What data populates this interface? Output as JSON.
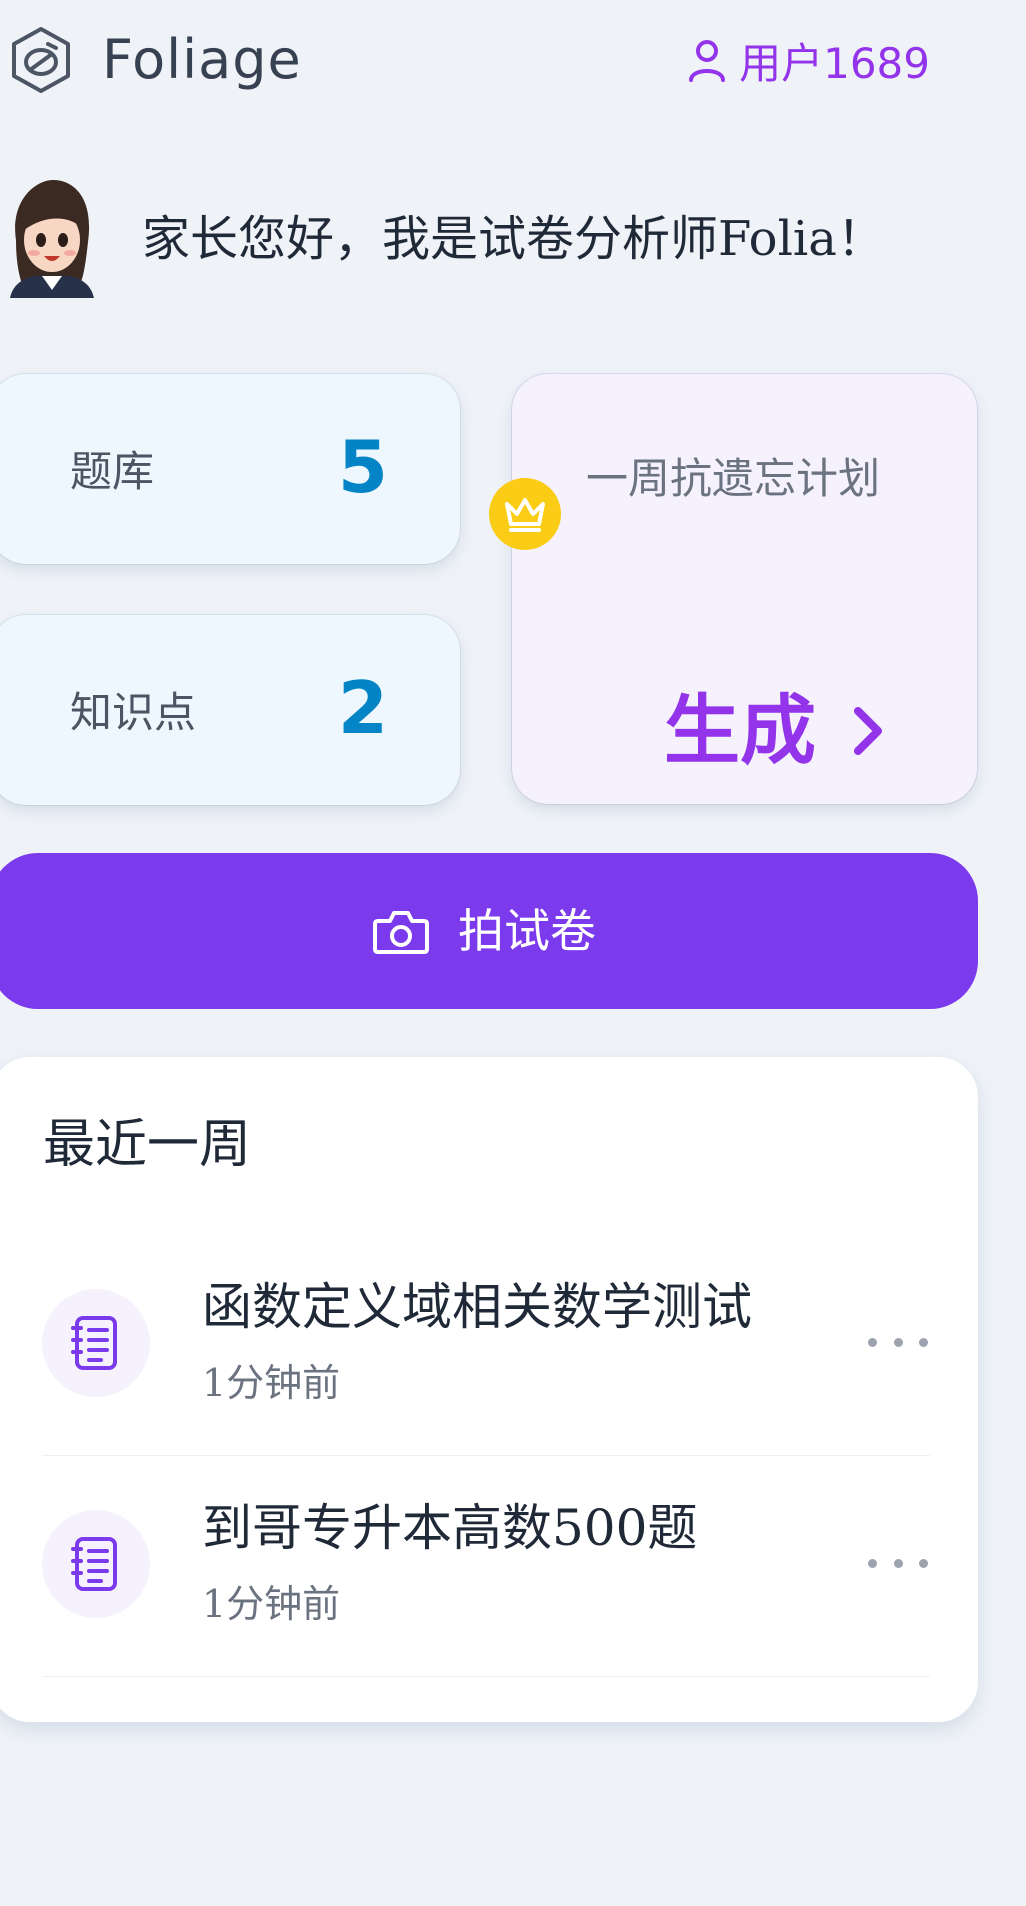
{
  "header": {
    "app_name": "Foliage",
    "user_label": "用户1689"
  },
  "greeting": {
    "text": "家长您好，我是试卷分析师Folia！"
  },
  "stats": [
    {
      "label": "题库",
      "value": "5"
    },
    {
      "label": "知识点",
      "value": "2"
    }
  ],
  "plan": {
    "title": "一周抗遗忘计划",
    "action": "生成"
  },
  "capture": {
    "label": "拍试卷"
  },
  "recent": {
    "title": "最近一周",
    "items": [
      {
        "title": "函数定义域相关数学测试",
        "time": "1分钟前"
      },
      {
        "title": "到哥专升本高数500题",
        "time": "1分钟前"
      }
    ]
  },
  "colors": {
    "accent": "#7c3aed",
    "accent_text": "#9333ea",
    "stat_value": "#0284c7",
    "crown": "#facc15",
    "background": "#eff3f8"
  },
  "icons": {
    "logo": "foliage-logo-icon",
    "user": "user-icon",
    "crown": "crown-icon",
    "chevron": "chevron-right-icon",
    "camera": "camera-icon",
    "document": "document-icon",
    "more": "more-icon"
  }
}
